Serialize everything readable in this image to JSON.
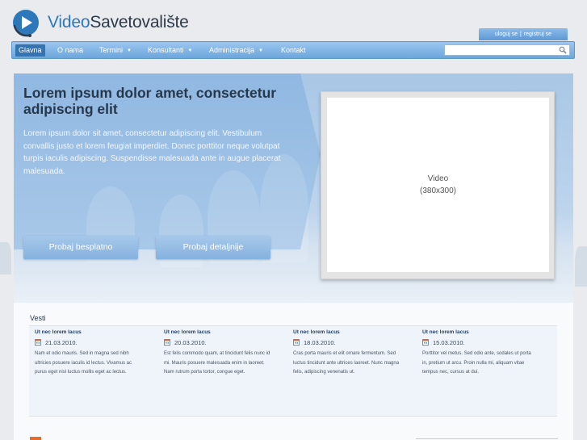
{
  "brand": {
    "name_part1": "Video",
    "name_part2": "Savetovalište"
  },
  "auth": {
    "login": "uloguj se",
    "separator": "|",
    "register": "registruj se"
  },
  "nav": {
    "items": [
      {
        "label": "Glavna",
        "active": true,
        "dropdown": false
      },
      {
        "label": "O nama",
        "dropdown": false
      },
      {
        "label": "Termini",
        "dropdown": true
      },
      {
        "label": "Konsultanti",
        "dropdown": true
      },
      {
        "label": "Administracija",
        "dropdown": true
      },
      {
        "label": "Kontakt",
        "dropdown": false
      }
    ],
    "search_value": ""
  },
  "hero": {
    "title": "Lorem ipsum dolor amet, consectetur adipiscing elit",
    "text": "Lorem ipsum dolor sit amet, consectetur adipiscing elit. Vestibulum convallis justo et lorem feugiat imperdiet. Donec porttitor neque volutpat turpis iaculis adipiscing. Suspendisse malesuada ante in augue placerat malesuada.",
    "btn_try": "Probaj besplatno",
    "btn_detail": "Probaj detaljnije",
    "video_label": "Video",
    "video_size": "(380x300)"
  },
  "news": {
    "title": "Vesti",
    "items": [
      {
        "headline": "Ut nec lorem lacus",
        "date": "21.03.2010.",
        "text": "Nam et odio mauris. Sed in magna sed nibh ultricies posuere iaculis id lectus. Vivamus ac purus eget nisl luctus mollis eget ac lectus."
      },
      {
        "headline": "Ut nec lorem lacus",
        "date": "20.03.2010.",
        "text": "Est felis commodo quam, at tincidunt felis nunc id mi. Mauris posuere malesuada enim in laoreet. Nam rutrum porta tortor, congue eget."
      },
      {
        "headline": "Ut nec lorem lacus",
        "date": "18.03.2010.",
        "text": "Cras porta mauris et elit ornare fermentum. Sed luctus tincidunt ante ultrices laoreet. Nunc magna felis, adipiscing venenatis ut."
      },
      {
        "headline": "Ut nec lorem lacus",
        "date": "15.03.2010.",
        "text": "Porttitor vel metus. Sed odio ante, sodales ut porta in, pretium ut arcu. Proin nulla mi, aliquam vitae tempus nec, cursus at dui."
      }
    ]
  },
  "colors": {
    "brand_blue": "#2d78ba",
    "nav_blue": "#6ca6dc",
    "nav_active": "#3574b3",
    "accent_orange": "#e66a2c"
  },
  "icons": {
    "logo": "play-headset-logo-icon",
    "search": "search-icon",
    "news_date": "calendar-icon",
    "dropdown": "caret-down-icon"
  }
}
